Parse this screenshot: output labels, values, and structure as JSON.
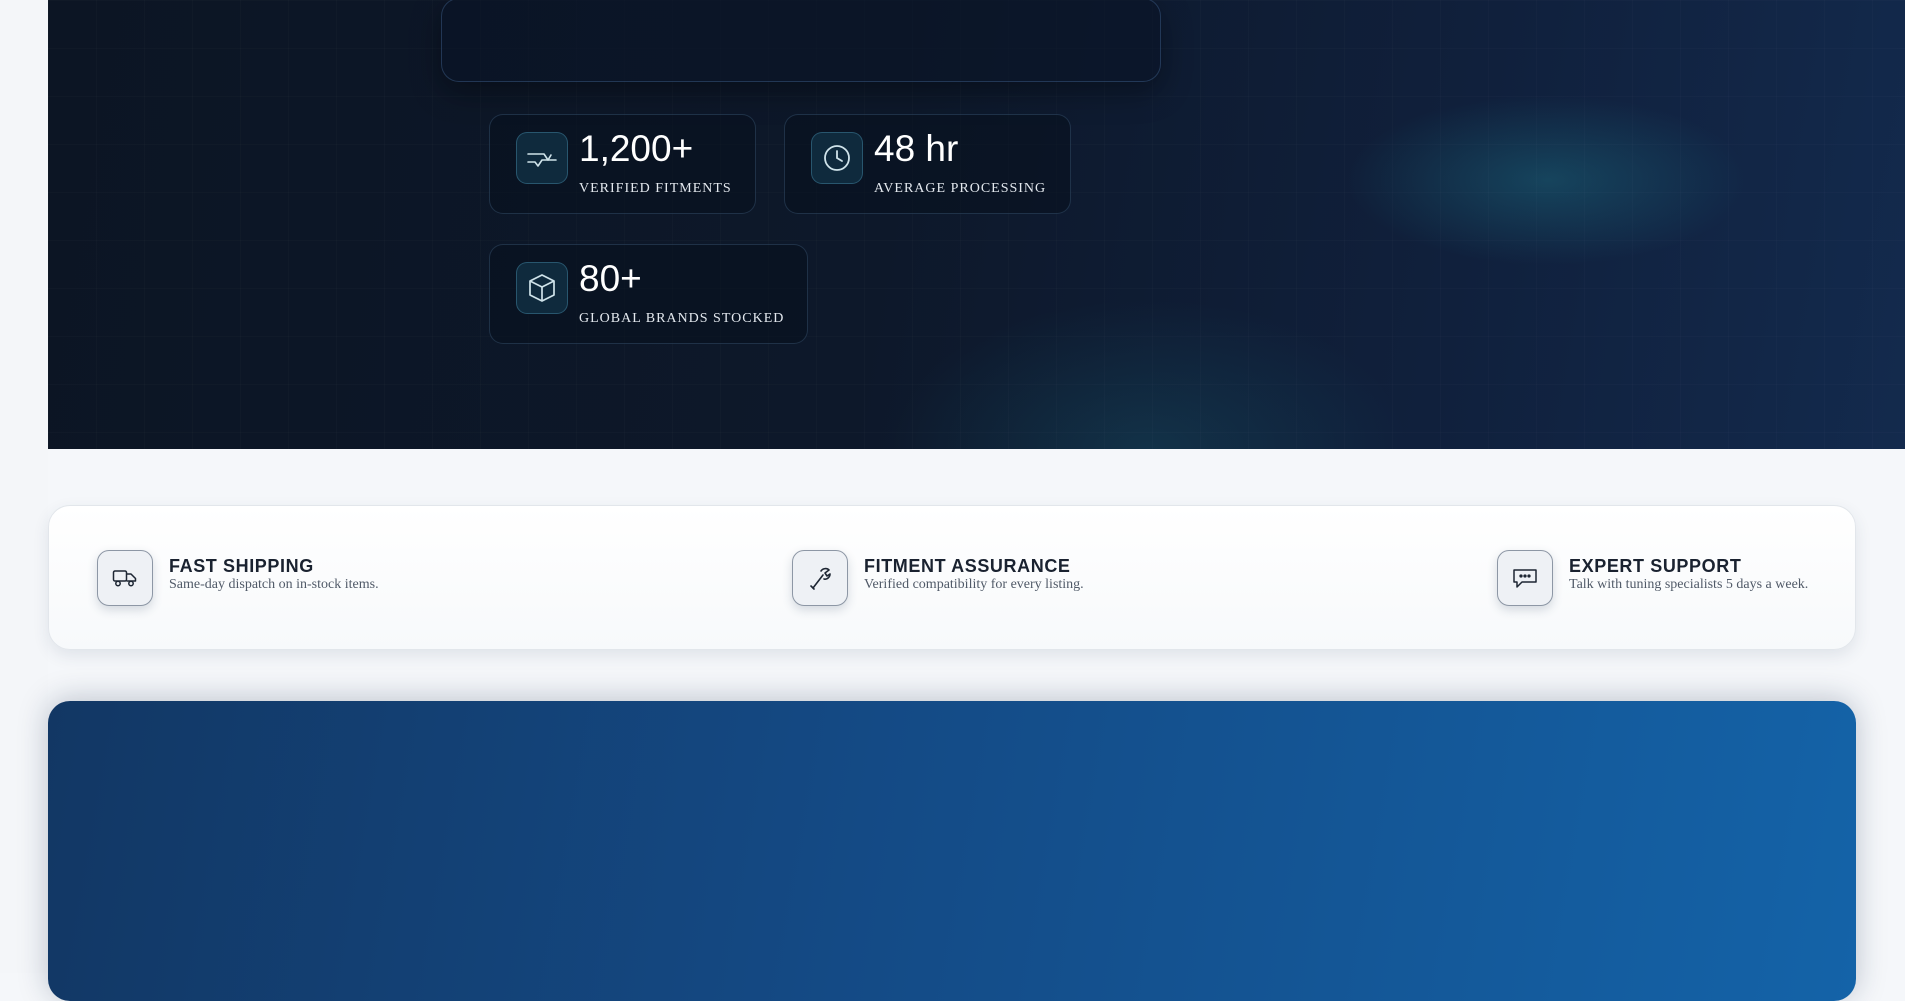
{
  "stats": [
    {
      "icon": "fitment-icon",
      "value": "1,200+",
      "label": "VERIFIED FITMENTS"
    },
    {
      "icon": "clock-icon",
      "value": "48 hr",
      "label": "AVERAGE PROCESSING"
    },
    {
      "icon": "box-icon",
      "value": "80+",
      "label": "GLOBAL BRANDS STOCKED"
    }
  ],
  "features": [
    {
      "icon": "truck-icon",
      "title": "FAST SHIPPING",
      "desc": "Same-day dispatch on in-stock items."
    },
    {
      "icon": "wrench-icon",
      "title": "FITMENT ASSURANCE",
      "desc": "Verified compatibility for every listing."
    },
    {
      "icon": "chat-icon",
      "title": "EXPERT SUPPORT",
      "desc": "Talk with tuning specialists 5 days a week."
    }
  ],
  "colors": {
    "hero_dark": "#0c1524",
    "accent_teal": "#0f2a3d",
    "panel_blue": "#144a85"
  }
}
